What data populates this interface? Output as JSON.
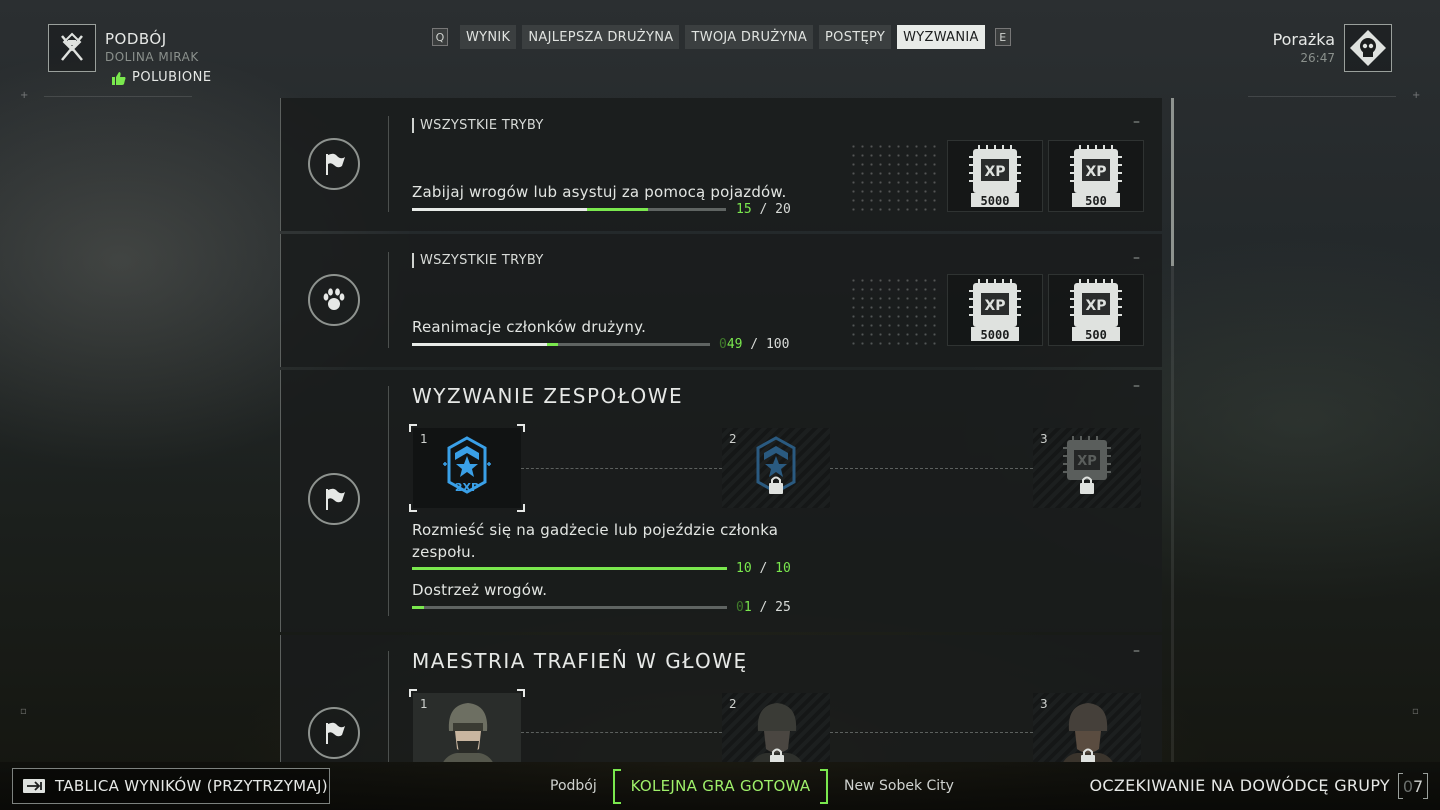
{
  "header": {
    "mode_title": "PODBÓJ",
    "map_name": "DOLINA MIRAK",
    "liked_label": "POLUBIONE",
    "result": "Porażka",
    "timer": "26:47"
  },
  "tabs": {
    "left_key": "Q",
    "right_key": "E",
    "items": [
      "WYNIK",
      "NAJLEPSZA DRUŻYNA",
      "TWOJA DRUŻYNA",
      "POSTĘPY",
      "WYZWANIA"
    ],
    "active": "WYZWANIA"
  },
  "challenges": [
    {
      "mode": "WSZYSTKIE TRYBY",
      "description": "Zabijaj wrogów lub asystuj za pomocą pojazdów.",
      "current": "15",
      "total": "20",
      "progress": 0.75,
      "rewards": [
        {
          "label": "XP",
          "amount": "5000"
        },
        {
          "label": "XP",
          "amount": "500"
        }
      ],
      "icon": "flag-icon"
    },
    {
      "mode": "WSZYSTKIE TRYBY",
      "description": "Reanimacje członków drużyny.",
      "current_prefix": "0",
      "current": "49",
      "total": "100",
      "progress": 0.49,
      "rewards": [
        {
          "label": "XP",
          "amount": "5000"
        },
        {
          "label": "XP",
          "amount": "500"
        }
      ],
      "icon": "paw-icon"
    }
  ],
  "team_challenge": {
    "title": "WYZWANIE ZESPOŁOWE",
    "tiers": [
      {
        "num": "1",
        "label": "2XP",
        "locked": false
      },
      {
        "num": "2",
        "locked": true
      },
      {
        "num": "3",
        "label": "XP",
        "locked": true
      }
    ],
    "tasks": [
      {
        "description": "Rozmieść się na gadżecie lub pojeździe członka zespołu.",
        "current": "10",
        "total": "10",
        "progress": 1.0
      },
      {
        "description": "Dostrzeż wrogów.",
        "current_prefix": "0",
        "current": "1",
        "total": "25",
        "progress": 0.04
      }
    ]
  },
  "headshot_challenge": {
    "title": "MAESTRIA TRAFIEŃ W GŁOWĘ",
    "tiers": [
      {
        "num": "1",
        "locked": false
      },
      {
        "num": "2",
        "locked": true
      },
      {
        "num": "3",
        "locked": true
      }
    ]
  },
  "footer": {
    "scoreboard_label": "TABLICA WYNIKÓW (PRZYTRZYMAJ)",
    "mode": "Podbój",
    "next_game": "KOLEJNA GRA GOTOWA",
    "next_map": "New Sobek City",
    "waiting_label": "OCZEKIWANIE NA DOWÓDCĘ GRUPY",
    "wait_prefix": "0",
    "wait_count": "7"
  },
  "colors": {
    "accent_green": "#7ae84e",
    "badge_blue": "#3aa0e8",
    "tab_active_bg": "#e8ebe8"
  }
}
